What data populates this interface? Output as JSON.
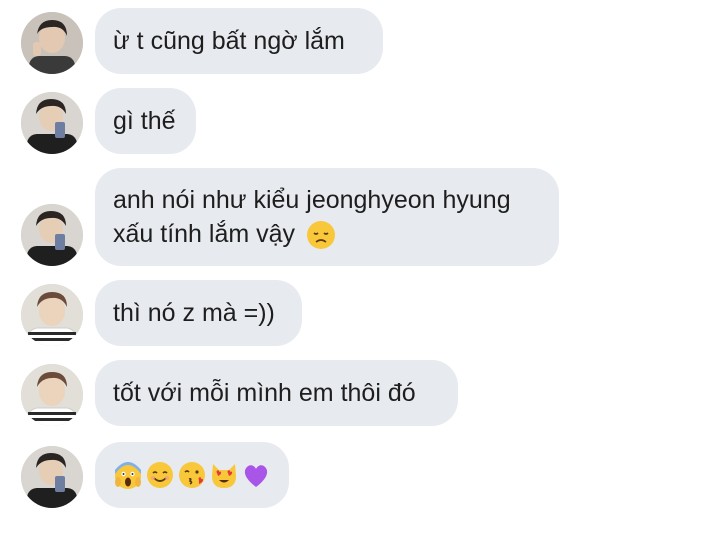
{
  "messages": [
    {
      "text": "ừ t cũng bất ngờ lắm",
      "avatar": "avatar-1"
    },
    {
      "text": "gì thế",
      "avatar": "avatar-2"
    },
    {
      "line1": "anh nói như kiểu jeonghyeon hyung",
      "line2": "xấu tính lắm vậy",
      "emoji": "disappointed-face",
      "avatar": "avatar-2"
    },
    {
      "text": "thì nó z mà =))",
      "avatar": "avatar-3"
    },
    {
      "text": "tốt với mỗi mình em thôi đó",
      "avatar": "avatar-3"
    },
    {
      "emojis": [
        "screaming-face",
        "smiling-face",
        "kissing-face",
        "heart-eyes-cat",
        "purple-heart"
      ],
      "avatar": "avatar-2"
    }
  ],
  "colors": {
    "bubble": "#e7eaee",
    "text": "#1e1e1e",
    "background": "#ffffff"
  }
}
